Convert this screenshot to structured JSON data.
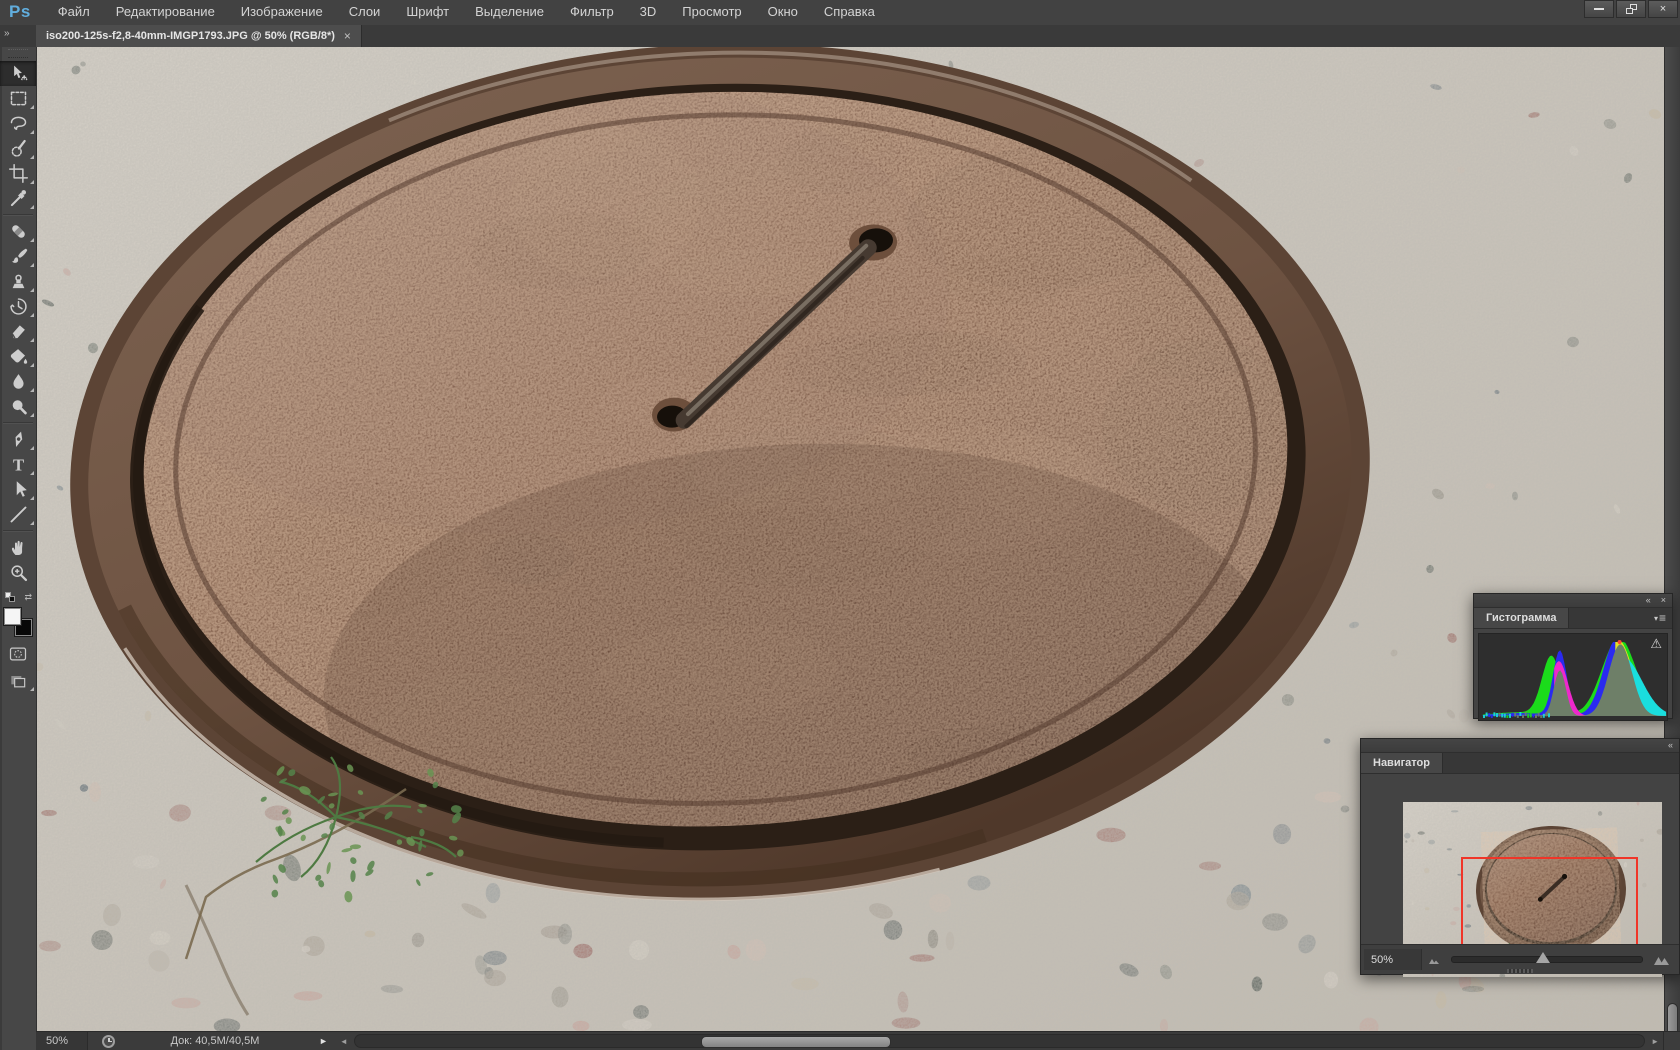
{
  "app": {
    "logo": "Ps",
    "window_controls": {
      "minimize": "minimize",
      "restore": "restore",
      "close": "×"
    }
  },
  "menu_bar": {
    "items": [
      "Файл",
      "Редактирование",
      "Изображение",
      "Слои",
      "Шрифт",
      "Выделение",
      "Фильтр",
      "3D",
      "Просмотр",
      "Окно",
      "Справка"
    ]
  },
  "tab_bar": {
    "toolbar_collapse_glyph": "»",
    "document_tab": {
      "title": "iso200-125s-f2,8-40mm-IMGP1793.JPG @ 50% (RGB/8*)",
      "close_label": "×"
    }
  },
  "toolbar": {
    "tools": [
      {
        "name": "move",
        "selected": true,
        "flyout": false
      },
      {
        "name": "rectangular-marquee",
        "flyout": true
      },
      {
        "name": "lasso",
        "flyout": true
      },
      {
        "name": "quick-selection",
        "flyout": true
      },
      {
        "name": "crop",
        "flyout": true
      },
      {
        "name": "eyedropper",
        "flyout": true
      },
      {
        "name": "spot-healing-brush",
        "flyout": true
      },
      {
        "name": "brush",
        "flyout": true
      },
      {
        "name": "clone-stamp",
        "flyout": true
      },
      {
        "name": "history-brush",
        "flyout": true
      },
      {
        "name": "eraser",
        "flyout": true
      },
      {
        "name": "gradient",
        "flyout": true
      },
      {
        "name": "blur",
        "flyout": true
      },
      {
        "name": "dodge",
        "flyout": true
      },
      {
        "name": "pen",
        "flyout": true
      },
      {
        "name": "horizontal-type",
        "flyout": true
      },
      {
        "name": "path-selection",
        "flyout": true
      },
      {
        "name": "line",
        "flyout": true
      },
      {
        "name": "hand",
        "flyout": false
      },
      {
        "name": "zoom",
        "flyout": false
      }
    ],
    "separators_after": [
      "eyedropper",
      "dodge",
      "line"
    ]
  },
  "panels": {
    "collapse_glyph": "«",
    "close_glyph": "×",
    "histogram": {
      "title": "Гистограмма",
      "warning_glyph": "⚠",
      "plot_bg": "#2e2e2e",
      "series": [
        {
          "color": "#1bdb1b",
          "clip": [
            0.02,
            0.995
          ],
          "peaks": [
            {
              "x": 0.385,
              "h": 0.8,
              "w": 0.05
            },
            {
              "x": 0.745,
              "h": 1.06,
              "w": 0.09
            },
            {
              "x": 0.2,
              "h": 0.05,
              "w": 0.13
            }
          ]
        },
        {
          "color": "#2a2af0",
          "clip": [
            0.02,
            0.995
          ],
          "peaks": [
            {
              "x": 0.43,
              "h": 0.88,
              "w": 0.037
            },
            {
              "x": 0.735,
              "h": 1.06,
              "w": 0.072
            },
            {
              "x": 0.22,
              "h": 0.04,
              "w": 0.12
            }
          ]
        },
        {
          "color": "#ee28cc",
          "clip": [
            0.4,
            0.62
          ],
          "peaks": [
            {
              "x": 0.425,
              "h": 0.74,
              "w": 0.048
            }
          ]
        },
        {
          "color": "#e6e022",
          "clip": [
            0.725,
            0.995
          ],
          "peaks": [
            {
              "x": 0.74,
              "h": 1.03,
              "w": 0.078
            }
          ]
        },
        {
          "color": "#1adede",
          "clip": [
            0.78,
            0.995
          ],
          "peaks": [
            {
              "x": 0.765,
              "h": 0.8,
              "w": 0.1
            }
          ]
        },
        {
          "color": "#6e7f68",
          "clip": [
            0.02,
            0.995
          ],
          "peaks": [
            {
              "x": 0.43,
              "h": 0.62,
              "w": 0.032
            },
            {
              "x": 0.752,
              "h": 0.97,
              "w": 0.062
            }
          ]
        }
      ],
      "baseline_colors": [
        "#1bdb1b",
        "#1adede",
        "#2a2af0",
        "#6e7f68"
      ],
      "clip_dot_color": "#ff4433"
    },
    "navigator": {
      "title": "Навигатор",
      "zoom_value": "50%"
    }
  },
  "status_bar": {
    "zoom_value": "50%",
    "doc_info": "Док: 40,5M/40,5M",
    "popup_glyph": "►"
  },
  "photo": {
    "concrete_base": "#c9c3b9",
    "pebble_colors": [
      "#b8b0a4",
      "#a79e92",
      "#8e8a80",
      "#6f7470",
      "#4e5852",
      "#c6b89f",
      "#d3c0b4",
      "#c9a29a",
      "#7c888e",
      "#9b6660",
      "#5d6b74",
      "#d9d3c9"
    ],
    "lid_gradient": [
      "#8d7060",
      "#7a5744",
      "#63473a"
    ],
    "rim_color": "#6e5342",
    "gap_color": "#2b1f16",
    "slot_bar_color": "#463a31",
    "hole_color": "#16100a",
    "plant_color": "#4e7a42",
    "wet_highlight": "#d6cabd"
  }
}
